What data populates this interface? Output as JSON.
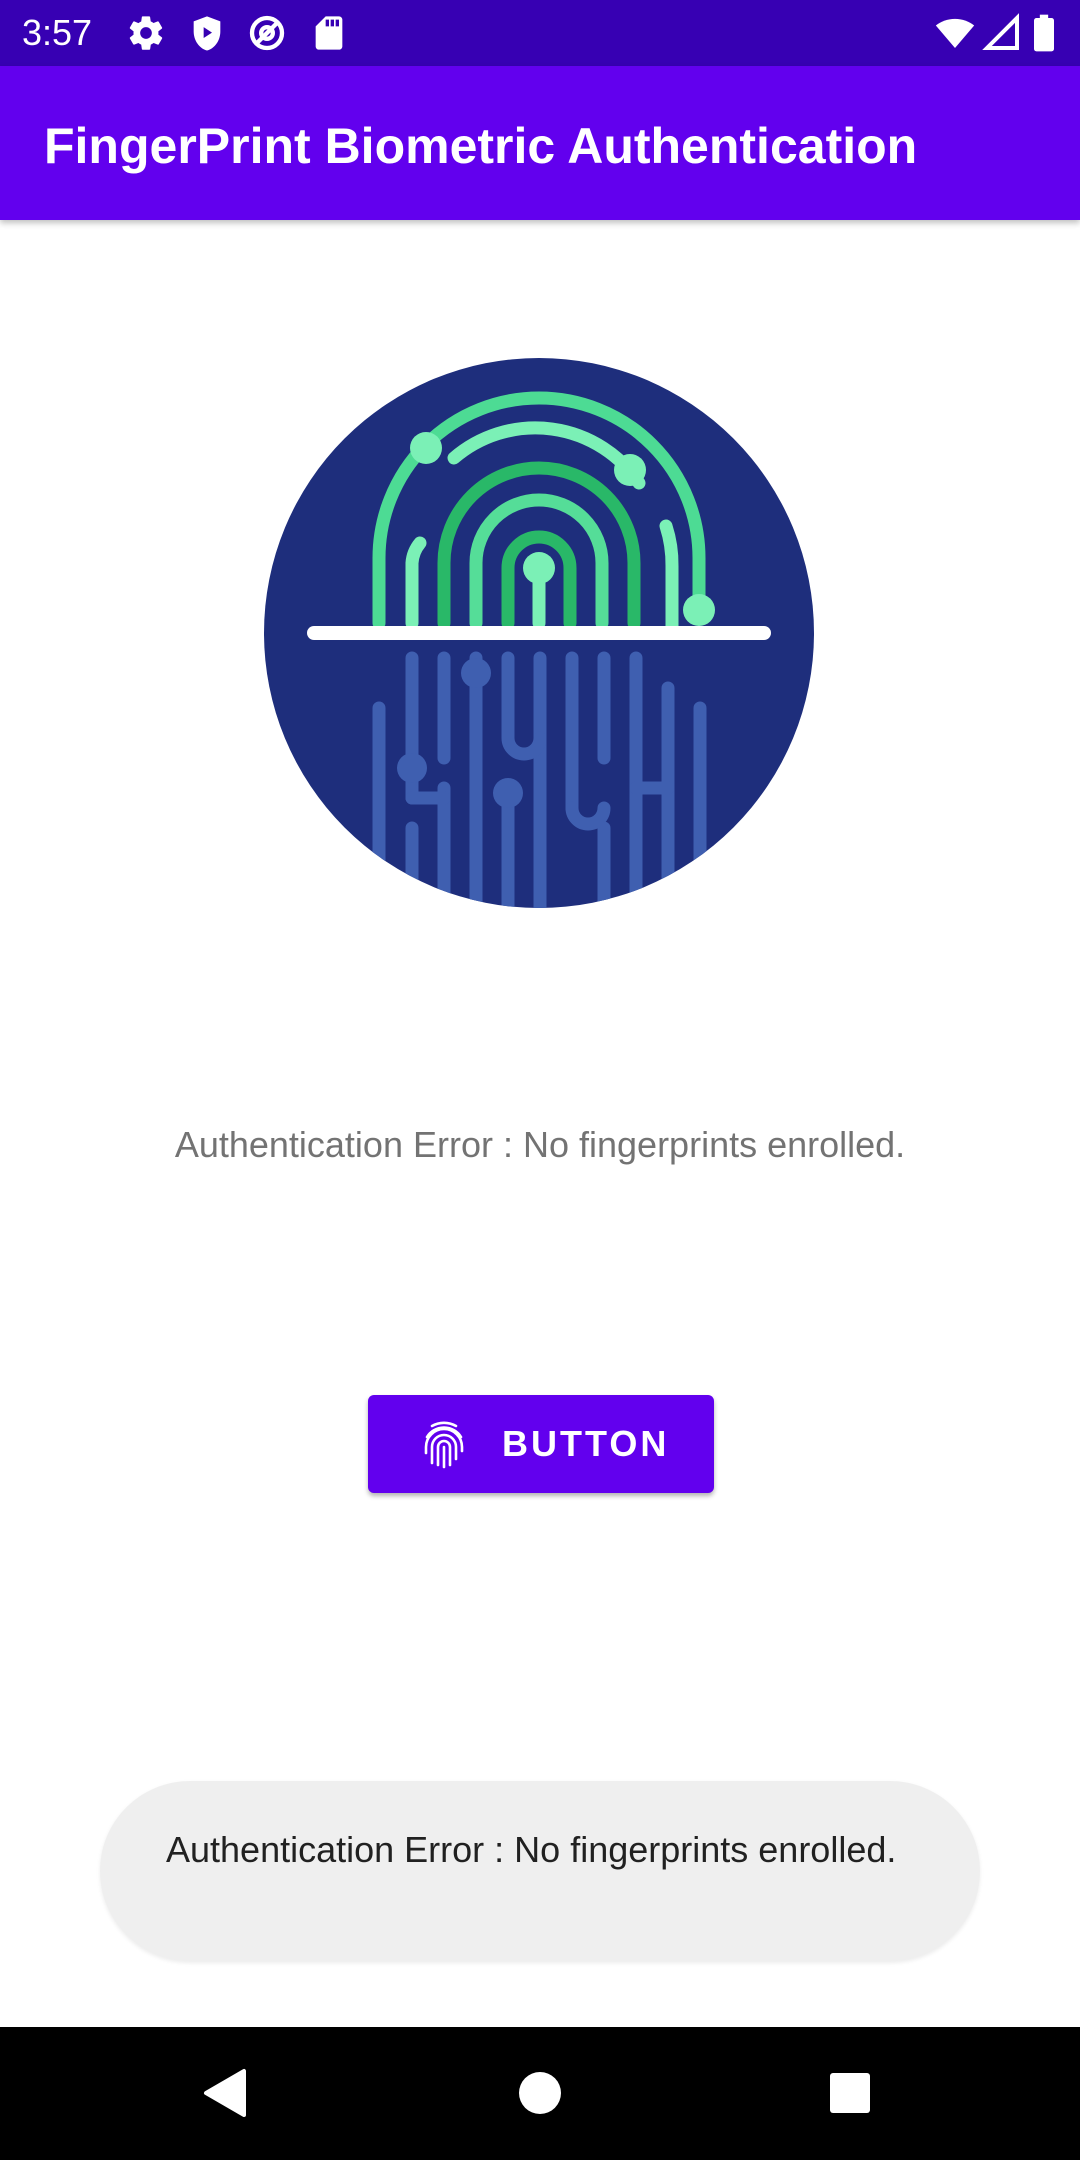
{
  "status_bar": {
    "time": "3:57",
    "left_icons": [
      "gear-icon",
      "shield-icon",
      "at-sign-icon",
      "sd-card-icon"
    ],
    "right_icons": [
      "wifi-icon",
      "cell-signal-icon",
      "battery-icon"
    ],
    "background": "#3700b3"
  },
  "app_bar": {
    "title": "FingerPrint Biometric Authentication",
    "background": "#6200ee"
  },
  "main": {
    "image_icon": "fingerprint-scan-icon",
    "message": "Authentication Error : No fingerprints enrolled.",
    "button": {
      "label": "BUTTON",
      "icon": "fingerprint-icon",
      "color": "#6200ee"
    }
  },
  "toast": {
    "text": "Authentication Error : No fingerprints enrolled."
  },
  "nav_bar": {
    "buttons": [
      "back-icon",
      "home-icon",
      "recents-icon"
    ]
  }
}
